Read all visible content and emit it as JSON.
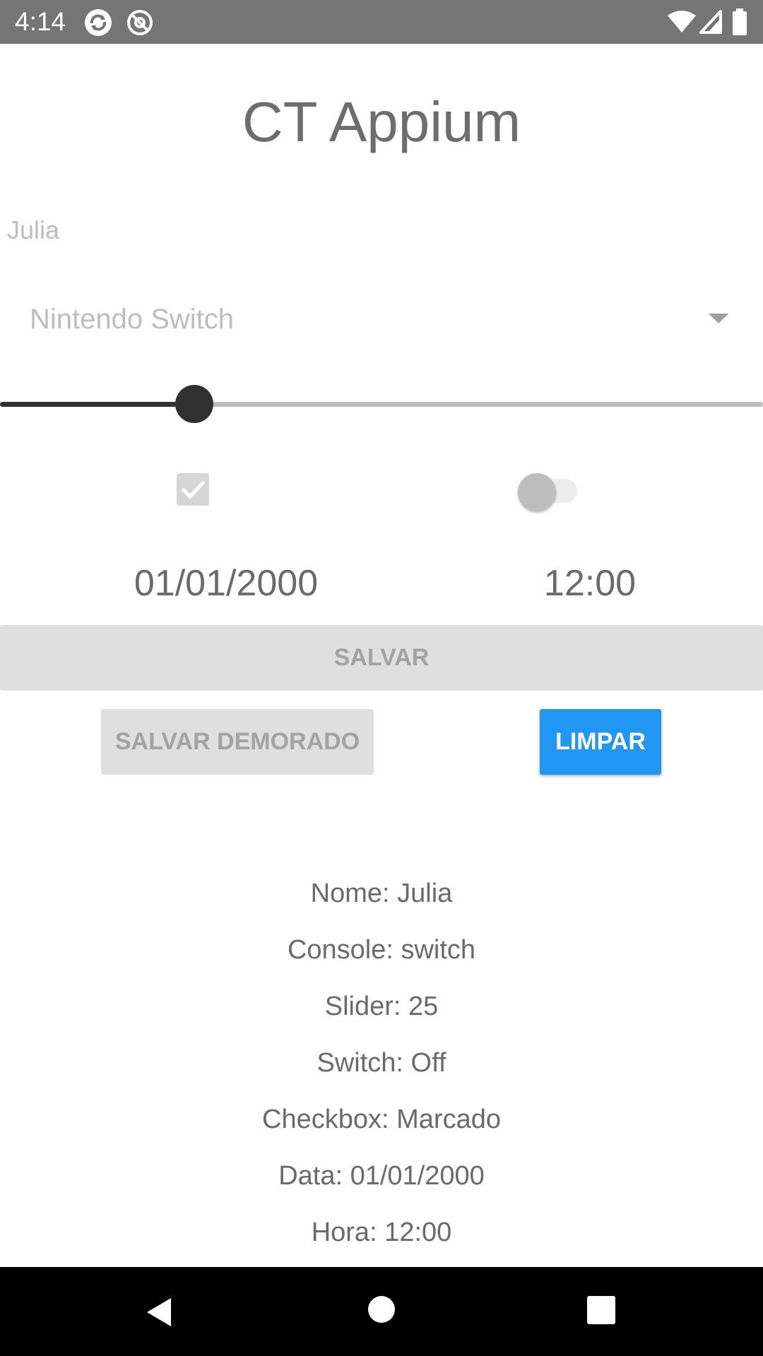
{
  "status_bar": {
    "time": "4:14",
    "left_icons": [
      "sync-icon",
      "at-sign-icon"
    ],
    "right_icons": [
      "wifi-icon",
      "cell-signal-icon",
      "battery-icon"
    ]
  },
  "app": {
    "title": "CT Appium"
  },
  "form": {
    "name_value": "Julia",
    "console_selected": "Nintendo Switch",
    "slider_value_fraction": 0.25,
    "checkbox_checked": true,
    "switch_on": false,
    "date": "01/01/2000",
    "time": "12:00"
  },
  "buttons": {
    "save": "SALVAR",
    "save_delayed": "SALVAR DEMORADO",
    "clear": "LIMPAR"
  },
  "results": [
    "Nome: Julia",
    "Console: switch",
    "Slider: 25",
    "Switch: Off",
    "Checkbox: Marcado",
    "Data: 01/01/2000",
    "Hora: 12:00"
  ],
  "nav_bar": {
    "icons": [
      "back-icon",
      "home-icon",
      "recents-icon"
    ]
  },
  "colors": {
    "accent": "#2196f3",
    "status_bar": "#757575",
    "slider_active": "#303030"
  }
}
